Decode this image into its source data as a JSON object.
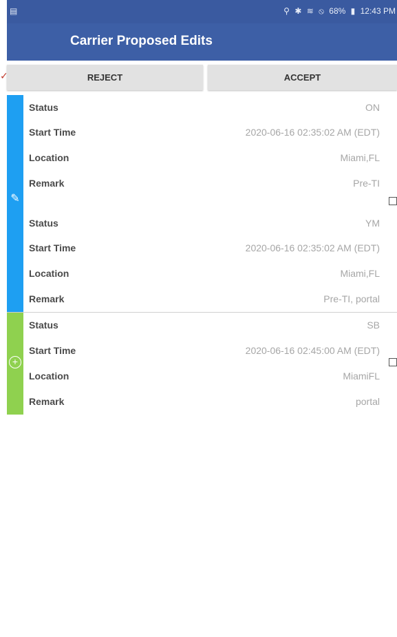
{
  "status_bar": {
    "left_icon": "notification-icon",
    "right_icons": [
      "location-icon",
      "bluetooth-icon",
      "wifi-icon",
      "do-not-disturb-icon"
    ],
    "battery": "68%",
    "time": "12:43 PM"
  },
  "header": {
    "title": "Carrier Proposed Edits"
  },
  "actions": {
    "reject_label": "REJECT",
    "accept_label": "ACCEPT"
  },
  "colors": {
    "app_bar": "#3d5fa6",
    "edit_stripe": "#1e9ff2",
    "add_stripe": "#8fd14f"
  },
  "groups": [
    {
      "type": "edit",
      "icon": "pencil-icon",
      "records": [
        {
          "rows": [
            {
              "label": "Status",
              "value": "ON"
            },
            {
              "label": "Start Time",
              "value": "2020-06-16 02:35:02 AM (EDT)"
            },
            {
              "label": "Location",
              "value": "Miami,FL"
            },
            {
              "label": "Remark",
              "value": "Pre-TI"
            }
          ]
        },
        {
          "rows": [
            {
              "label": "Status",
              "value": "YM"
            },
            {
              "label": "Start Time",
              "value": "2020-06-16 02:35:02 AM (EDT)"
            },
            {
              "label": "Location",
              "value": "Miami,FL"
            },
            {
              "label": "Remark",
              "value": "Pre-TI, portal"
            }
          ]
        }
      ]
    },
    {
      "type": "add",
      "icon": "add-circle-icon",
      "records": [
        {
          "rows": [
            {
              "label": "Status",
              "value": "SB"
            },
            {
              "label": "Start Time",
              "value": "2020-06-16 02:45:00 AM (EDT)"
            },
            {
              "label": "Location",
              "value": "MiamiFL"
            },
            {
              "label": "Remark",
              "value": "portal"
            }
          ]
        }
      ]
    }
  ]
}
